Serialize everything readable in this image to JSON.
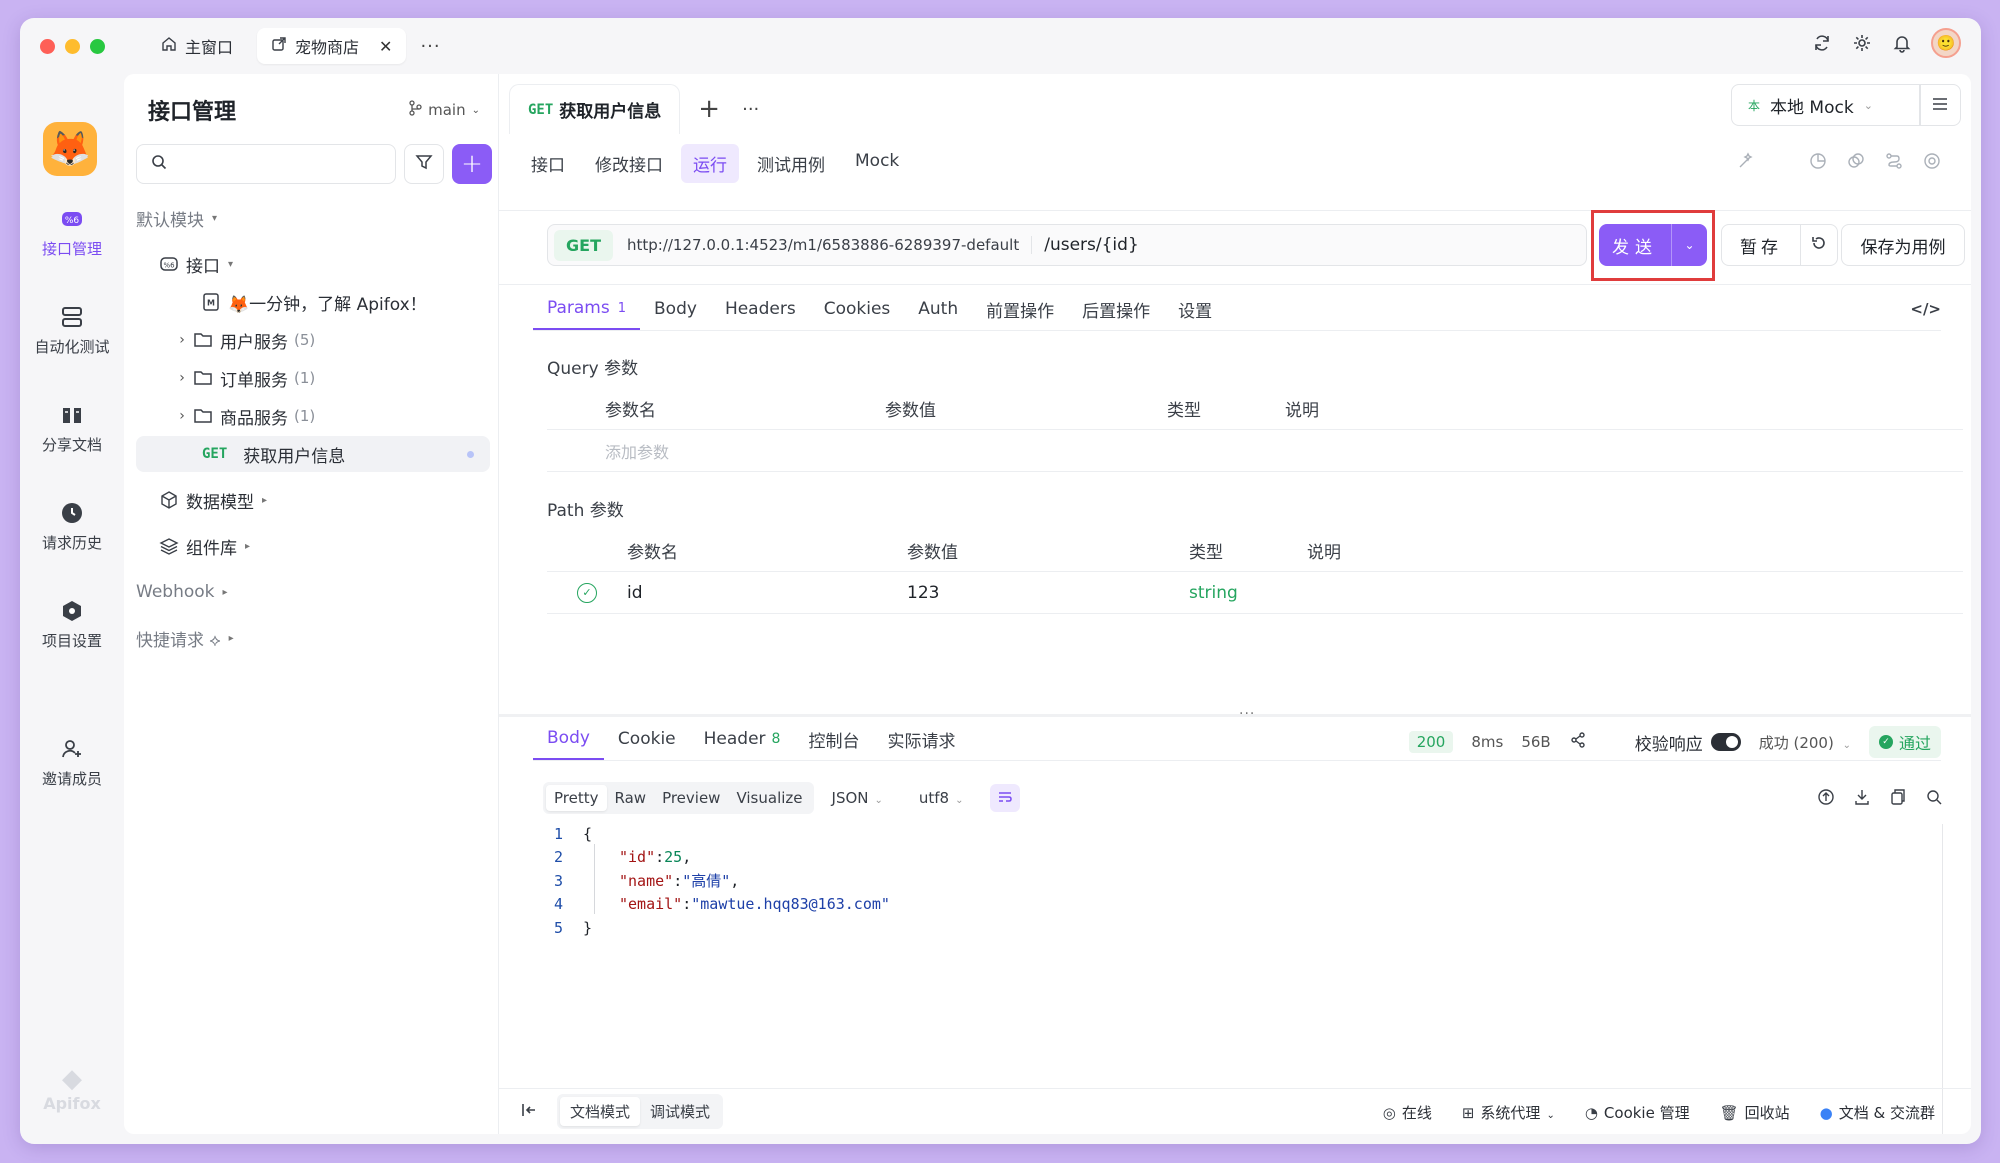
{
  "colors": {
    "accent": "#8b5cf6",
    "success": "#25a55f",
    "highlight": "#e03c3c"
  },
  "window_tabs": [
    {
      "label": "主窗口",
      "icon": "home-icon"
    },
    {
      "label": "宠物商店",
      "icon": "external-link-icon",
      "close": "✕"
    }
  ],
  "window_more": "···",
  "rail": {
    "items": [
      {
        "label": "接口管理",
        "icon": "api-icon"
      },
      {
        "label": "自动化测试",
        "icon": "automation-icon"
      },
      {
        "label": "分享文档",
        "icon": "book-icon"
      },
      {
        "label": "请求历史",
        "icon": "clock-icon"
      },
      {
        "label": "项目设置",
        "icon": "settings-hex-icon"
      },
      {
        "label": "邀请成员",
        "icon": "user-plus-icon"
      }
    ],
    "brand": "Apifox"
  },
  "sidebar": {
    "title": "接口管理",
    "branch": "main",
    "search_placeholder": "",
    "tree": {
      "default_module": "默认模块",
      "interfaces": "接口",
      "intro": "🦊一分钟，了解 Apifox！",
      "folders": [
        {
          "label": "用户服务",
          "count": "(5)"
        },
        {
          "label": "订单服务",
          "count": "(1)"
        },
        {
          "label": "商品服务",
          "count": "(1)"
        }
      ],
      "selected": {
        "method": "GET",
        "label": "获取用户信息"
      },
      "data_models": "数据模型",
      "components": "组件库",
      "webhook": "Webhook",
      "quick_request": "快捷请求 ⟡"
    }
  },
  "main": {
    "doc_tab": {
      "method": "GET",
      "label": "获取用户信息"
    },
    "mock_env": {
      "badge": "本",
      "label": "本地 Mock"
    },
    "sub_tabs": [
      "接口",
      "修改接口",
      "运行",
      "测试用例",
      "Mock"
    ],
    "url": {
      "method": "GET",
      "base": "http://127.0.0.1:4523/m1/6583886-6289397-default",
      "path": "/users/{id}"
    },
    "buttons": {
      "send": "发送",
      "save": "暂存",
      "save_case": "保存为用例"
    },
    "req_tabs": [
      {
        "label": "Params",
        "count": "1"
      },
      {
        "label": "Body"
      },
      {
        "label": "Headers"
      },
      {
        "label": "Cookies"
      },
      {
        "label": "Auth"
      },
      {
        "label": "前置操作"
      },
      {
        "label": "后置操作"
      },
      {
        "label": "设置"
      }
    ],
    "query": {
      "label": "Query 参数",
      "headers": [
        "参数名",
        "参数值",
        "类型",
        "说明"
      ],
      "add_placeholder": "添加参数"
    },
    "path_params": {
      "label": "Path 参数",
      "headers": [
        "参数名",
        "参数值",
        "类型",
        "说明"
      ],
      "rows": [
        {
          "name": "id",
          "value": "123",
          "type": "string",
          "desc": ""
        }
      ]
    },
    "resp_tabs": [
      {
        "label": "Body"
      },
      {
        "label": "Cookie"
      },
      {
        "label": "Header",
        "count": "8"
      },
      {
        "label": "控制台"
      },
      {
        "label": "实际请求"
      }
    ],
    "resp_meta": {
      "status": "200",
      "time": "8ms",
      "size": "56B",
      "validate_label": "校验响应",
      "validate_select": "成功 (200)",
      "result": "通过"
    },
    "format": {
      "views": [
        "Pretty",
        "Raw",
        "Preview",
        "Visualize"
      ],
      "type": "JSON",
      "encoding": "utf8"
    },
    "code": [
      {
        "n": "1",
        "text": "{"
      },
      {
        "n": "2",
        "key": "\"id\"",
        "val": "25",
        "kind": "num"
      },
      {
        "n": "3",
        "key": "\"name\"",
        "val": "\"高倩\"",
        "kind": "str"
      },
      {
        "n": "4",
        "key": "\"email\"",
        "val": "\"mawtue.hqq83@163.com\"",
        "kind": "str"
      },
      {
        "n": "5",
        "text": "}"
      }
    ]
  },
  "footer": {
    "modes": [
      "文档模式",
      "调试模式"
    ],
    "items": [
      {
        "label": "在线",
        "icon": "online-check-icon"
      },
      {
        "label": "系统代理",
        "icon": "network-icon"
      },
      {
        "label": "Cookie 管理",
        "icon": "cookie-icon"
      },
      {
        "label": "回收站",
        "icon": "trash-icon"
      },
      {
        "label": "文档 & 交流群",
        "icon": "chat-icon"
      }
    ]
  }
}
